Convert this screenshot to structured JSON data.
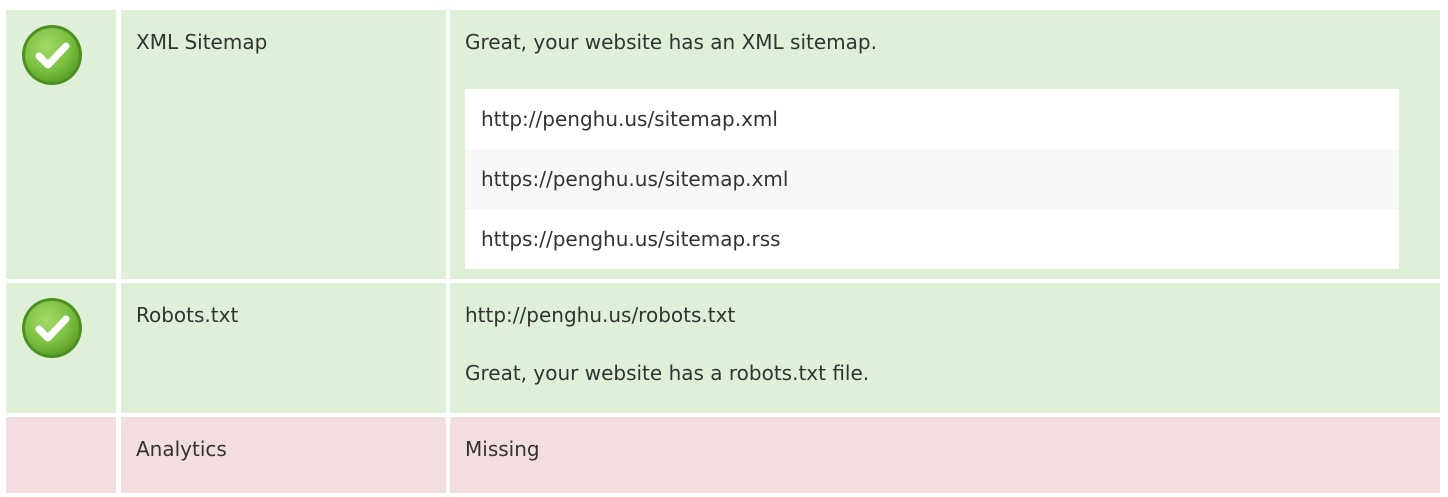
{
  "rows": [
    {
      "status": "pass",
      "label": "XML Sitemap",
      "message": "Great, your website has an XML sitemap.",
      "urls": [
        "http://penghu.us/sitemap.xml",
        "https://penghu.us/sitemap.xml",
        "https://penghu.us/sitemap.rss"
      ]
    },
    {
      "status": "pass",
      "label": "Robots.txt",
      "url": "http://penghu.us/robots.txt",
      "message": "Great, your website has a robots.txt file."
    },
    {
      "status": "fail",
      "label": "Analytics",
      "value": "Missing"
    }
  ],
  "colors": {
    "pass_bg": "#dff0d8",
    "fail_bg": "#f2dede",
    "check_green": "#7cc242"
  },
  "icons": {
    "pass": "check-circle-icon"
  }
}
